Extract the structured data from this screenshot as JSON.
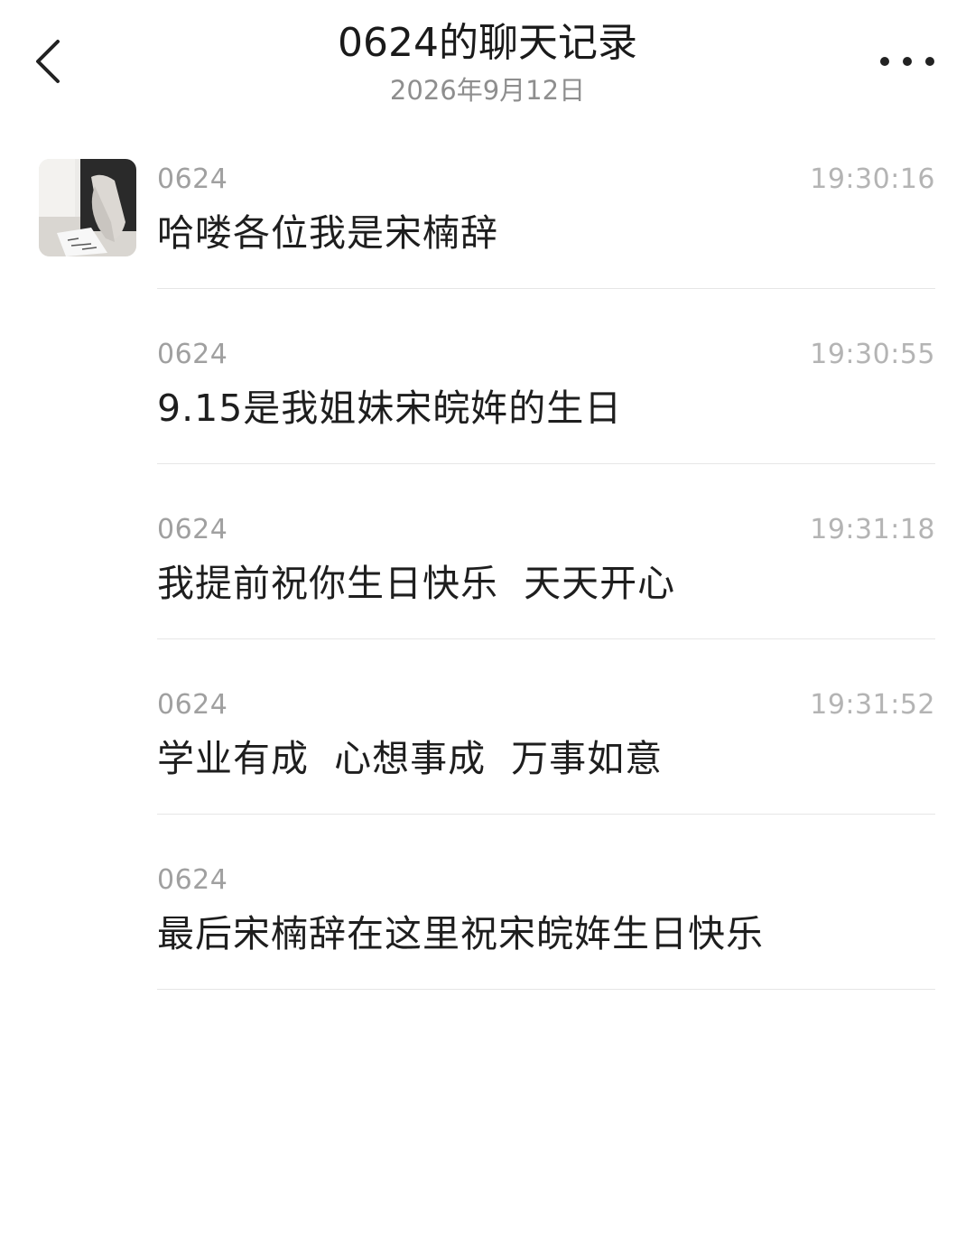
{
  "header": {
    "title": "0624的聊天记录",
    "date": "2026年9月12日",
    "back_icon": "chevron-left-icon",
    "more_icon": "more-horizontal-icon"
  },
  "messages": [
    {
      "sender": "0624",
      "time": "19:30:16",
      "text": "哈喽各位我是宋楠辞"
    },
    {
      "sender": "0624",
      "time": "19:30:55",
      "text": "9.15是我姐妹宋皖姩的生日"
    },
    {
      "sender": "0624",
      "time": "19:31:18",
      "text": "我提前祝你生日快乐  天天开心"
    },
    {
      "sender": "0624",
      "time": "19:31:52",
      "text": "学业有成  心想事成  万事如意"
    },
    {
      "sender": "0624",
      "time": "",
      "text": "最后宋楠辞在这里祝宋皖姩生日快乐"
    }
  ],
  "colors": {
    "title": "#1a1a1a",
    "subtitle": "#8e8e8e",
    "sender": "#a0a0a0",
    "time": "#b4b4b4",
    "divider": "#e6e6e6"
  }
}
